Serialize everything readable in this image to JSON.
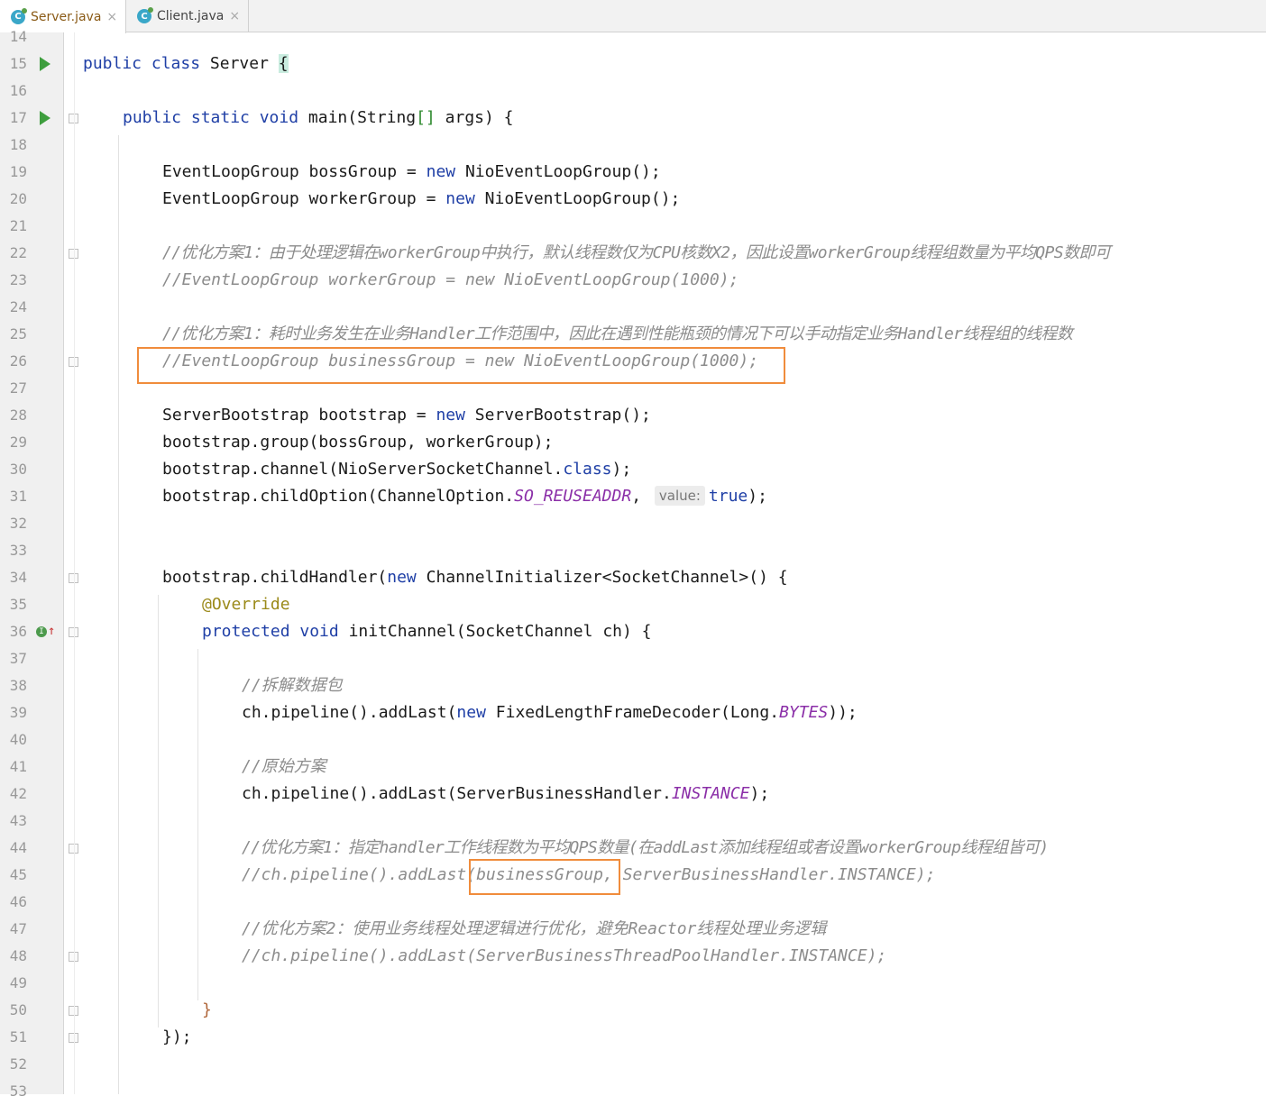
{
  "tabs": [
    {
      "label": "Server.java",
      "icon": "java-class-icon",
      "active": true
    },
    {
      "label": "Client.java",
      "icon": "java-class-icon",
      "active": false
    }
  ],
  "tab_close_glyph": "×",
  "file_icon_letter": "C",
  "line_numbers": [
    "14",
    "15",
    "16",
    "17",
    "18",
    "19",
    "20",
    "21",
    "22",
    "23",
    "24",
    "25",
    "26",
    "27",
    "28",
    "29",
    "30",
    "31",
    "32",
    "33",
    "34",
    "35",
    "36",
    "37",
    "38",
    "39",
    "40",
    "41",
    "42",
    "43",
    "44",
    "45",
    "46",
    "47",
    "48",
    "49",
    "50",
    "51",
    "52",
    "53"
  ],
  "code": {
    "l15": {
      "kw1": "public class ",
      "name": "Server ",
      "brace": "{"
    },
    "l17": {
      "kw": "public static void ",
      "rest": "main(String",
      "arr": "[]",
      "args": " args) {"
    },
    "l19": {
      "a": "EventLoopGroup bossGroup = ",
      "kw": "new ",
      "b": "NioEventLoopGroup",
      "c": "();"
    },
    "l20": {
      "a": "EventLoopGroup workerGroup = ",
      "kw": "new ",
      "b": "NioEventLoopGroup",
      "c": "();"
    },
    "l22": "//优化方案1：由于处理逻辑在workerGroup中执行，默认线程数仅为CPU核数X2，因此设置workerGroup线程组数量为平均QPS数即可",
    "l23": "//EventLoopGroup workerGroup = new NioEventLoopGroup(1000);",
    "l25": "//优化方案1：耗时业务发生在业务Handler工作范围中，因此在遇到性能瓶颈的情况下可以手动指定业务Handler线程组的线程数",
    "l26": "//EventLoopGroup businessGroup = new NioEventLoopGroup(1000);",
    "l28": {
      "a": "ServerBootstrap bootstrap = ",
      "kw": "new ",
      "b": "ServerBootstrap",
      "c": "();"
    },
    "l29": "bootstrap.group(bossGroup, workerGroup);",
    "l30": {
      "a": "bootstrap.channel(NioServerSocketChannel.",
      "kw": "class",
      "c": ");"
    },
    "l31": {
      "a": "bootstrap.childOption(ChannelOption.",
      "st": "SO_REUSEADDR",
      "b": ", ",
      "hint": "value:",
      "kw": "true",
      "c": ");"
    },
    "l34": {
      "a": "bootstrap.childHandler(",
      "kw": "new ",
      "b": "ChannelInitializer<SocketChannel>() {"
    },
    "l35": "@Override",
    "l36": {
      "kw": "protected void ",
      "b": "initChannel(SocketChannel ch) {"
    },
    "l38": "//拆解数据包",
    "l39": {
      "a": "ch.pipeline().addLast(",
      "kw": "new ",
      "b": "FixedLengthFrameDecoder(Long.",
      "st": "BYTES",
      "c": "));"
    },
    "l41": "//原始方案",
    "l42": {
      "a": "ch.pipeline().addLast(ServerBusinessHandler.",
      "st": "INSTANCE",
      "c": ");"
    },
    "l44": "//优化方案1：指定handler工作线程数为平均QPS数量(在addLast添加线程组或者设置workerGroup线程组皆可)",
    "l45": "//ch.pipeline().addLast(businessGroup, ServerBusinessHandler.INSTANCE);",
    "l47": "//优化方案2：使用业务线程处理逻辑进行优化，避免Reactor线程处理业务逻辑",
    "l48": "//ch.pipeline().addLast(ServerBusinessThreadPoolHandler.INSTANCE);",
    "l50": "}",
    "l51": "});"
  },
  "colors": {
    "keyword": "#1f3fa6",
    "comment": "#8c8c8c",
    "static_field": "#8b2fa8",
    "annotation": "#9b8a1a",
    "highlight_box": "#f08c3c"
  }
}
